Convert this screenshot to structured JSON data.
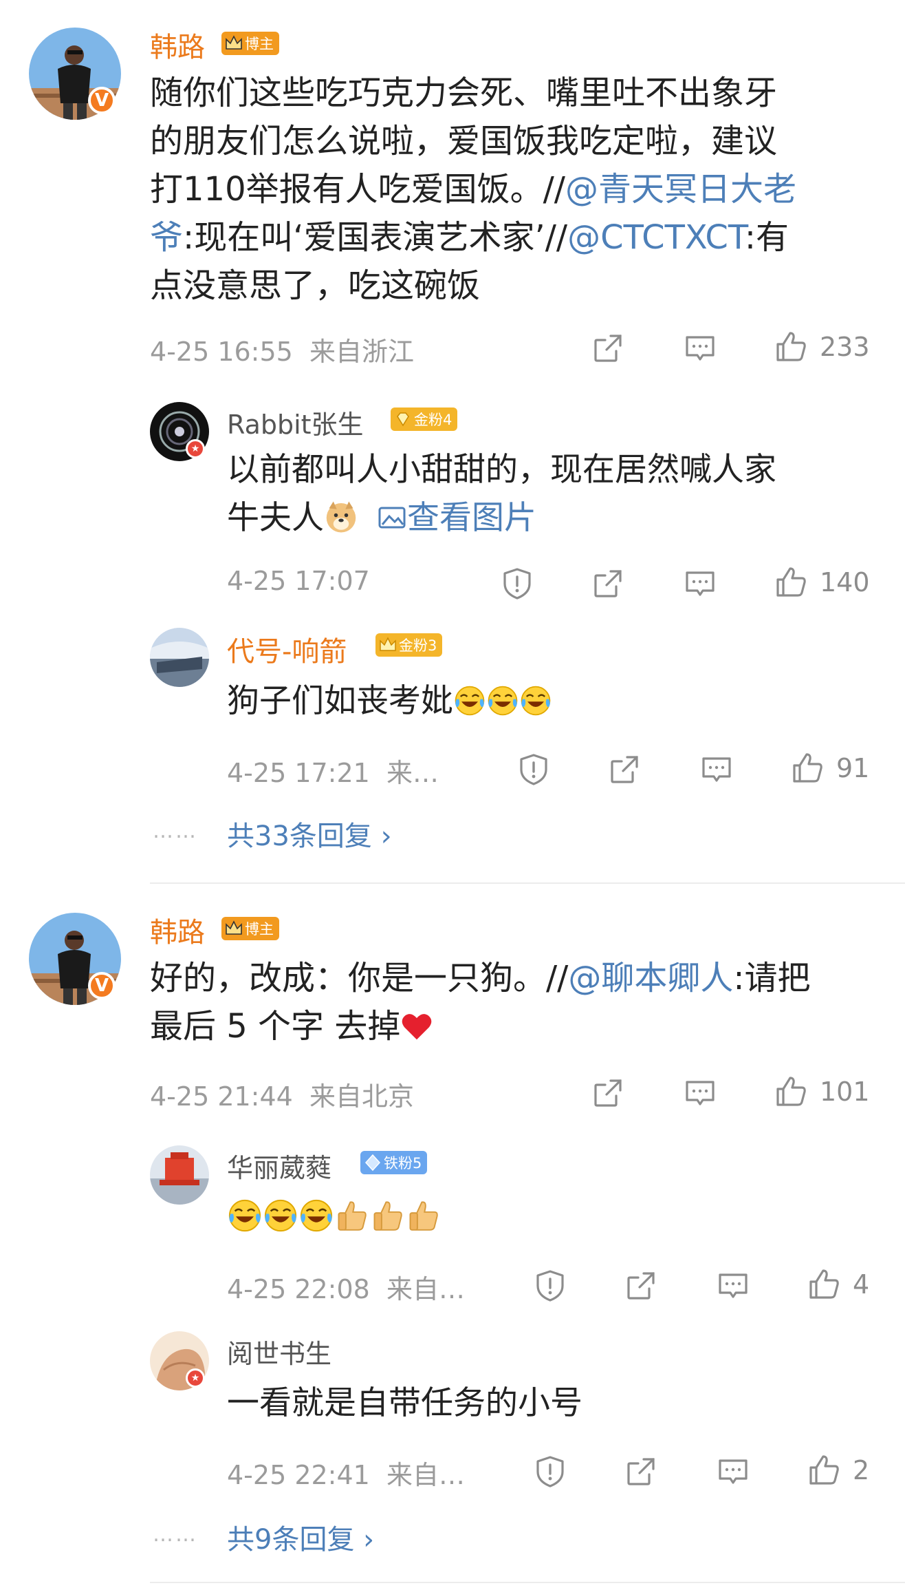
{
  "comments": [
    {
      "author": "韩路",
      "tag": "博主",
      "text_lines": [
        "随你们这些吃巧克力会死、嘴里吐不出象牙",
        "的朋友们怎么说啦，爱国饭我吃定啦，建议"
      ],
      "line3_text": "打110举报有人吃爱国饭。//",
      "line3_link": "@青天冥日大老",
      "line4_link": "爷",
      "line4_text": ":现在叫‘爱国表演艺术家’//",
      "line4_link2": "@CTCTXCT",
      "line4_tail": ":有",
      "line5_text": "点没意思了，吃这碗饭",
      "time": "4-25 16:55",
      "location": "来自浙江",
      "likes": "233",
      "replies": [
        {
          "author": "Rabbit张生",
          "tag": "金粉4",
          "line1": "以前都叫人小甜甜的，现在居然喊人家",
          "line2": "牛夫人",
          "pic_link": "查看图片",
          "time": "4-25 17:07",
          "likes": "140"
        },
        {
          "author": "代号-响箭",
          "tag": "金粉3",
          "text": "狗子们如丧考妣",
          "time": "4-25 17:21",
          "location": "来…",
          "likes": "91"
        }
      ],
      "more_dots": "……",
      "more_replies": "共33条回复 ›"
    },
    {
      "author": "韩路",
      "tag": "博主",
      "line1_text": "好的，改成：你是一只狗。//",
      "line1_link": "@聊本卿人",
      "line1_tail": ":请把",
      "line2_text": "最后 5 个字 去掉",
      "time": "4-25 21:44",
      "location": "来自北京",
      "likes": "101",
      "replies": [
        {
          "author": "华丽葳蕤",
          "tag": "铁粉5",
          "time": "4-25 22:08",
          "location": "来自…",
          "likes": "4"
        },
        {
          "author": "阅世书生",
          "text": "一看就是自带任务的小号",
          "time": "4-25 22:41",
          "location": "来自…",
          "likes": "2"
        }
      ],
      "more_dots": "……",
      "more_replies": "共9条回复 ›"
    }
  ],
  "colors": {
    "author": "#eb7a1c",
    "link": "#4d7fb8",
    "meta": "#9b9b9b",
    "gold_tag": "#f4b52a",
    "iron_tag": "#6aa6ef",
    "blogger_tag": "#f29a1f"
  },
  "icons": [
    "share-icon",
    "comment-icon",
    "like-icon",
    "report-icon",
    "image-icon",
    "chevron-right-icon"
  ]
}
